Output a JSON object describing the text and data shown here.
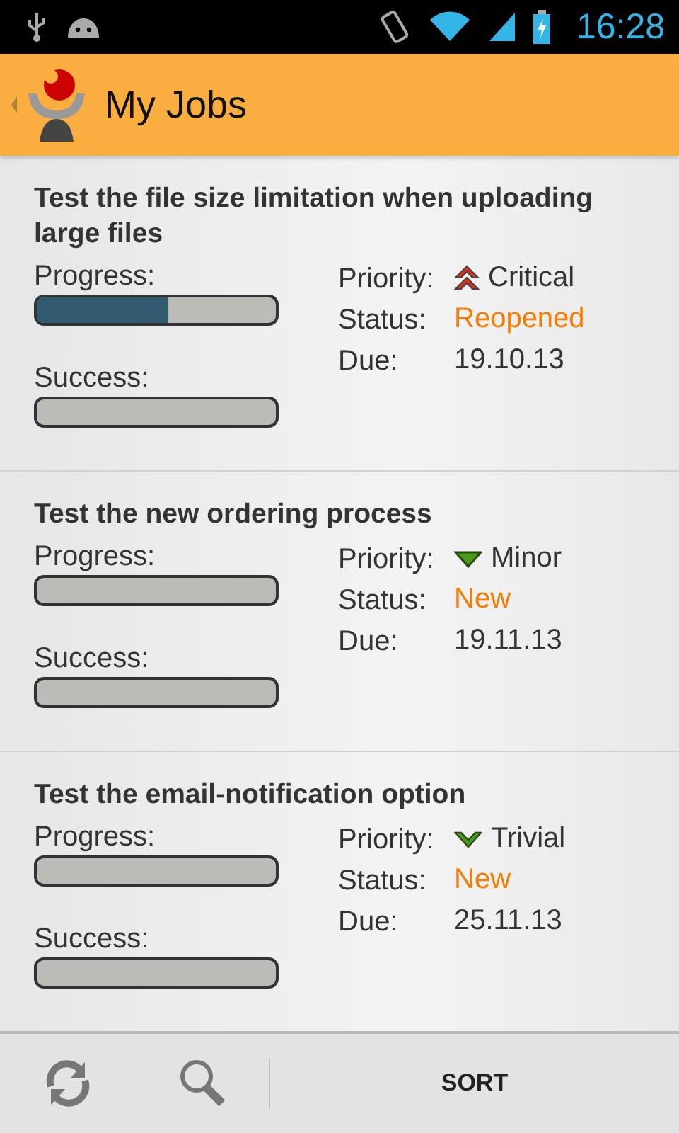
{
  "status_bar": {
    "time": "16:28"
  },
  "action_bar": {
    "title": "My Jobs"
  },
  "jobs": [
    {
      "title": "Test the file size limitation when uploading large files",
      "progress_label": "Progress:",
      "progress": {
        "level": 0.55
      },
      "success_label": "Success:",
      "priority_label": "Priority:",
      "priority": {
        "kind": "critical",
        "text": "Critical"
      },
      "status_label": "Status:",
      "status": "Reopened",
      "due_label": "Due:",
      "due": "19.10.13"
    },
    {
      "title": "Test the new ordering process",
      "progress_label": "Progress:",
      "success_label": "Success:",
      "priority_label": "Priority:",
      "priority": {
        "kind": "minor",
        "text": "Minor"
      },
      "status_label": "Status:",
      "status": "New",
      "due_label": "Due:",
      "due": "19.11.13"
    },
    {
      "title": "Test the email-notification option",
      "progress_label": "Progress:",
      "success_label": "Success:",
      "priority_label": "Priority:",
      "priority": {
        "kind": "trivial",
        "text": "Trivial"
      },
      "status_label": "Status:",
      "status": "New",
      "due_label": "Due:",
      "due": "25.11.13"
    }
  ],
  "bottom_bar": {
    "sort": "SORT"
  }
}
